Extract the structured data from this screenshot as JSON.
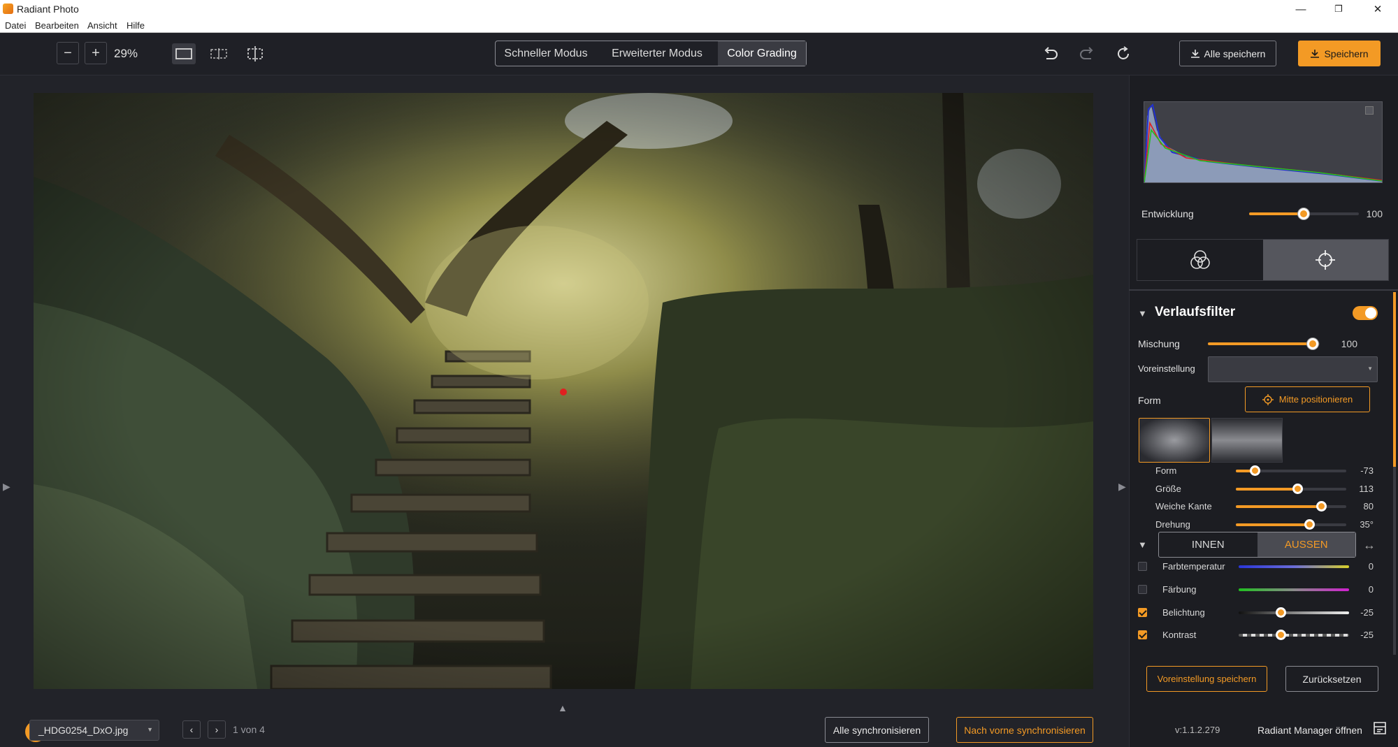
{
  "window": {
    "title": "Radiant Photo",
    "minimize": "—",
    "maximize": "❐",
    "close": "✕"
  },
  "menu": [
    "Datei",
    "Bearbeiten",
    "Ansicht",
    "Hilfe"
  ],
  "toolbar": {
    "zoom_out": "−",
    "zoom_in": "+",
    "zoom_level": "29%",
    "modes": [
      "Schneller Modus",
      "Erweiterter Modus",
      "Color Grading"
    ],
    "active_mode": "Color Grading",
    "save_all_label": "Alle speichern",
    "save_label": "Speichern"
  },
  "canvas": {
    "left_arrow": "▶",
    "right_arrow": "▶",
    "up_arrow": "▲"
  },
  "bottom": {
    "filename": "_HDG0254_DxO.jpg",
    "prev": "‹",
    "next": "›",
    "page": "1 von 4",
    "sync_all": "Alle synchronisieren",
    "sync_forward": "Nach vorne synchronisieren"
  },
  "panel": {
    "development": {
      "label": "Entwicklung",
      "value": 100,
      "min": 0,
      "max": 100
    },
    "section_title": "Verlaufsfilter",
    "section_enabled": true,
    "mix": {
      "label": "Mischung",
      "value": 100
    },
    "preset_label": "Voreinstellung",
    "preset_value": "",
    "form_label": "Form",
    "center_button": "Mitte positionieren",
    "shape_sliders": [
      {
        "label": "Form",
        "value": "-73",
        "pos": 0.18
      },
      {
        "label": "Größe",
        "value": "113",
        "pos": 0.56
      },
      {
        "label": "Weiche Kante",
        "value": "80",
        "pos": 0.77
      },
      {
        "label": "Drehung",
        "value": "35°",
        "pos": 0.67
      }
    ],
    "inout": [
      "INNEN",
      "AUSSEN"
    ],
    "inout_active": "AUSSEN",
    "adjustments": [
      {
        "label": "Farbtemperatur",
        "checked": false,
        "value": "0"
      },
      {
        "label": "Färbung",
        "checked": false,
        "value": "0"
      },
      {
        "label": "Belichtung",
        "checked": true,
        "value": "-25",
        "pos": 0.38
      },
      {
        "label": "Kontrast",
        "checked": true,
        "value": "-25",
        "pos": 0.38
      }
    ],
    "save_preset": "Voreinstellung speichern",
    "reset": "Zurücksetzen",
    "version": "v:1.1.2.279",
    "manager": "Radiant Manager öffnen"
  },
  "colors": {
    "accent": "#f39a25",
    "background": "#222329",
    "panel": "#1c1d22"
  }
}
